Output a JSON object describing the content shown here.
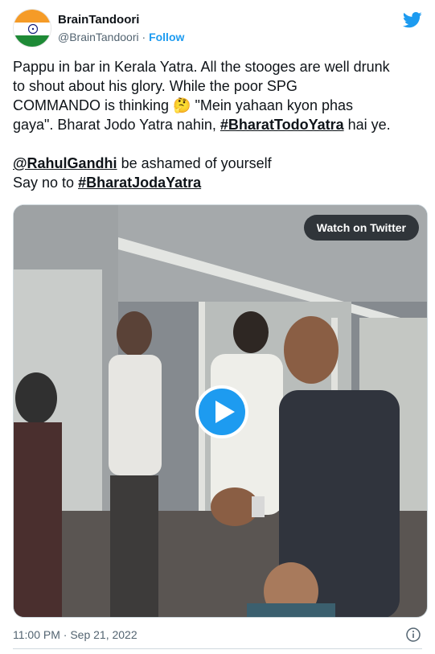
{
  "author": {
    "display_name": "BrainTandoori",
    "handle": "@BrainTandoori",
    "separator": "·",
    "follow_label": "Follow"
  },
  "icons": {
    "avatar": "india-flag-avatar",
    "brand": "twitter-bird-icon",
    "play": "play-icon",
    "info": "info-icon"
  },
  "tweet": {
    "line1": "Pappu in bar in Kerala Yatra. All the stooges are well drunk",
    "line2": "to shout about his glory. While the poor SPG",
    "line3_pre": "COMMANDO is thinking ",
    "emoji": "🤔",
    "line3_post": " \"Mein yahaan kyon phas",
    "line4_pre": "gaya\". Bharat Jodo Yatra nahin, ",
    "hashtag1": "#BharatTodoYatra",
    "line4_post": " hai ye.",
    "mention": "@RahulGandhi",
    "line5_post": " be ashamed of yourself",
    "line6_pre": "Say no to ",
    "hashtag2": "#BharatJodaYatra"
  },
  "media": {
    "watch_label": "Watch on Twitter"
  },
  "footer": {
    "timestamp": "11:00 PM · Sep 21, 2022"
  },
  "colors": {
    "accent": "#1d9bf0",
    "text": "#0f1419",
    "muted": "#536471",
    "saffron": "#f59b27",
    "green": "#1e8a36"
  }
}
